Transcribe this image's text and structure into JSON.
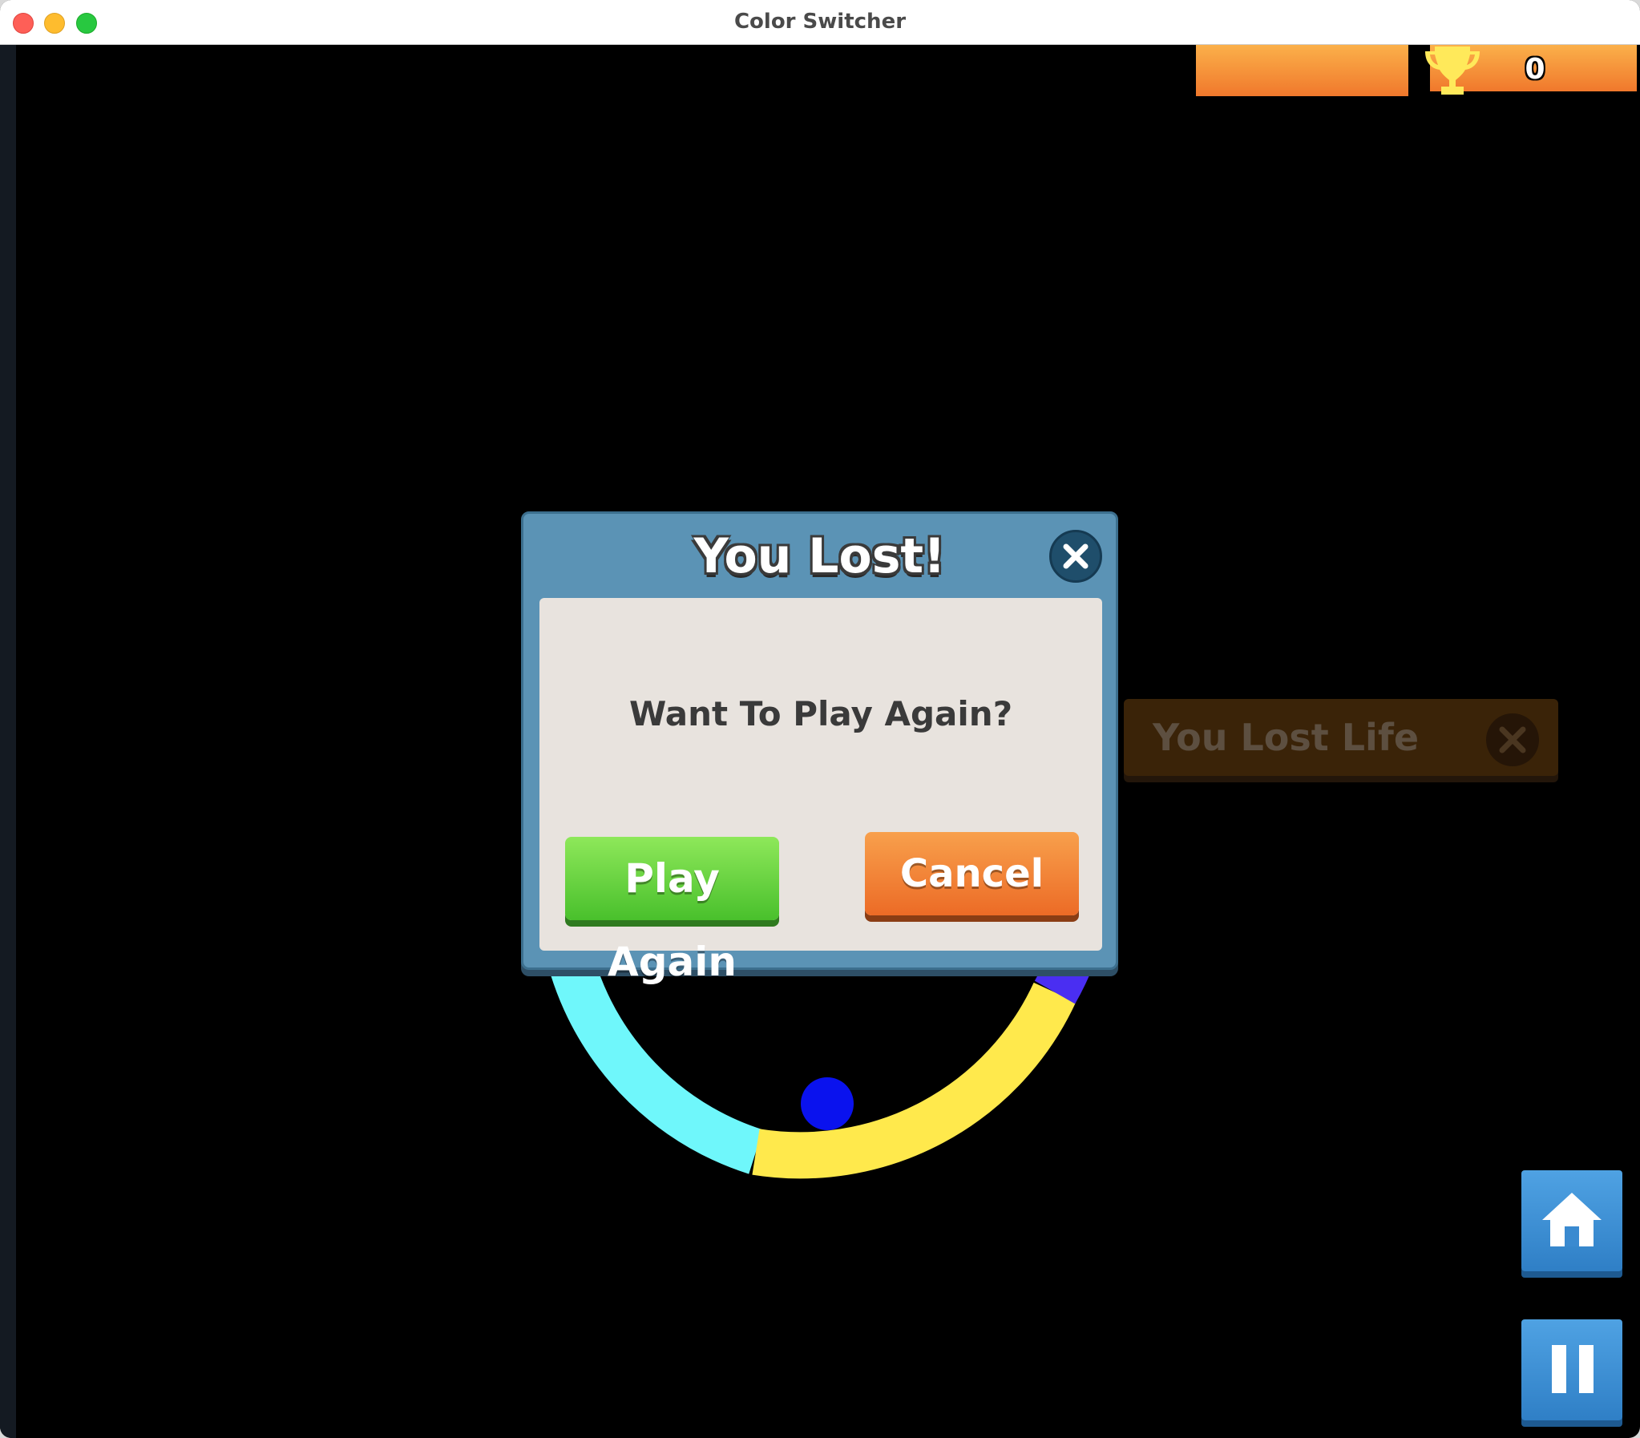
{
  "window": {
    "title": "Color Switcher"
  },
  "hud": {
    "score": "0",
    "trophy_icon": "trophy-icon"
  },
  "dialog": {
    "title": "You Lost!",
    "message": "Want To Play Again?",
    "play_again_label": "Play Again",
    "cancel_label": "Cancel",
    "close_icon": "close-icon"
  },
  "life_toast": {
    "text": "You Lost Life",
    "close_icon": "close-icon"
  },
  "controls": {
    "home_icon": "home-icon",
    "pause_icon": "pause-icon"
  },
  "colors": {
    "cyan": "#6ff7fb",
    "yellow": "#ffe94c",
    "purple": "#4a2ef2",
    "ball": "#0a12ee",
    "dialog_frame": "#5b93b5",
    "hud_orange": "#f4903a"
  }
}
